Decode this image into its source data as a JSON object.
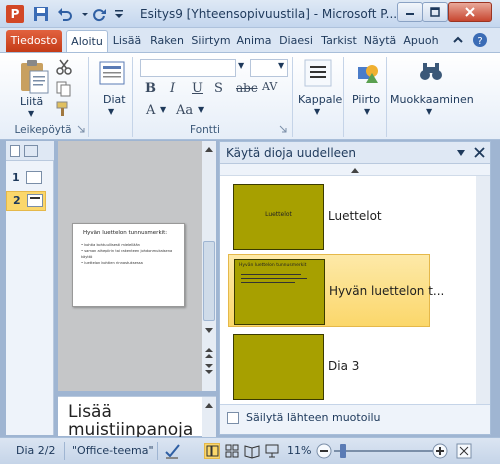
{
  "window": {
    "title": "Esitys9 [Yhteensopivuustila] - Microsoft P...",
    "app_letter": "P"
  },
  "tabs": {
    "file": "Tiedosto",
    "items": [
      "Aloitu",
      "Lisää",
      "Raken",
      "Siirtym",
      "Anima",
      "Diaesi",
      "Tarkist",
      "Näytä",
      "Apuoh"
    ]
  },
  "ribbon": {
    "clipboard": {
      "paste": "Liitä",
      "group": "Leikepöytä"
    },
    "slides": {
      "new_slide": "Diat"
    },
    "font": {
      "group": "Fontti",
      "bold": "B",
      "italic": "I",
      "underline": "U",
      "shadow": "S",
      "strike": "abc",
      "spacing": "AV",
      "grow": "A",
      "case": "Aa"
    },
    "paragraph": {
      "label": "Kappale"
    },
    "drawing": {
      "label": "Piirto"
    },
    "editing": {
      "label": "Muokkaaminen"
    }
  },
  "slide_panel": {
    "slides": [
      {
        "num": "1",
        "selected": false
      },
      {
        "num": "2",
        "selected": true
      }
    ]
  },
  "current_slide": {
    "title": "Hyvän luettelon tunnusmerkit:",
    "bullets": [
      "kohtia kohtuullisesti mielellään",
      "saman aihepiirin tai rakenteen johdonmukaisena käyttö",
      "luettelon kohtien rinnastuksessa"
    ]
  },
  "notes": {
    "text": "Lisää muistiinpanoja"
  },
  "reuse_pane": {
    "title": "Käytä dioja uudelleen",
    "items": [
      {
        "label": "Luettelot",
        "thumb_title": "Luettelot",
        "selected": false
      },
      {
        "label": "Hyvän luettelon t...",
        "thumb_title": "Hyvän luettelon tunnusmerkit",
        "selected": true
      },
      {
        "label": "Dia 3",
        "thumb_title": "",
        "selected": false
      }
    ],
    "keep_format": "Säilytä lähteen muotoilu"
  },
  "status": {
    "slide_counter": "Dia 2/2",
    "theme": "\"Office-teema\"",
    "zoom": "11%"
  },
  "colors": {
    "accent": "#d24726",
    "thumb": "#a7a000",
    "selection": "#fbd76b"
  }
}
